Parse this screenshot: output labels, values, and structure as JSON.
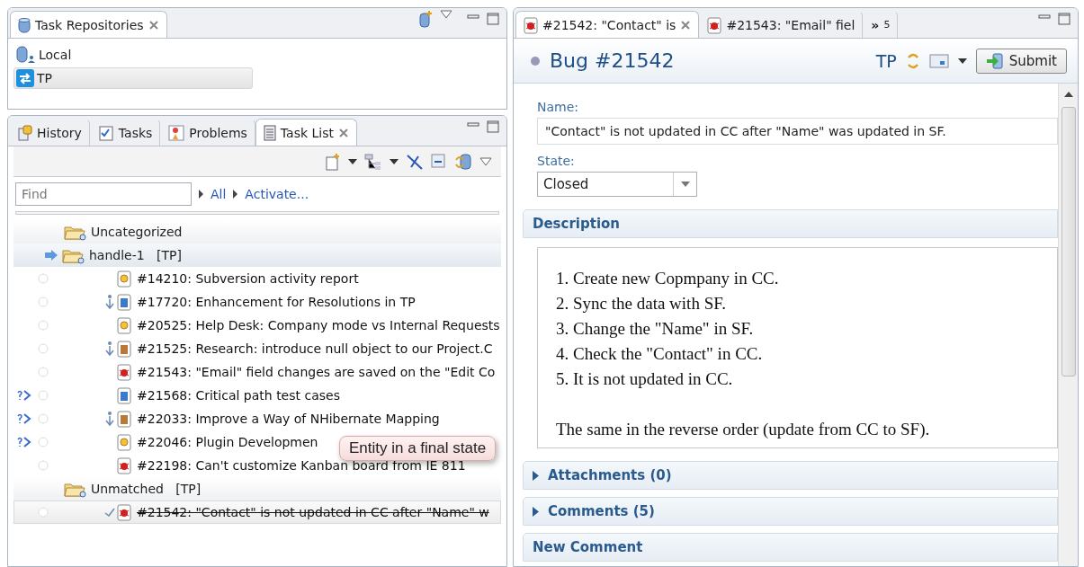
{
  "repositories": {
    "tab": {
      "label": "Task Repositories"
    },
    "items": [
      {
        "label": "Local",
        "kind": "local",
        "selected": false
      },
      {
        "label": "TP",
        "kind": "remote",
        "selected": true
      }
    ]
  },
  "task_view": {
    "tabs": [
      {
        "label": "History",
        "kind": "history",
        "selected": false
      },
      {
        "label": "Tasks",
        "kind": "tasks",
        "selected": false
      },
      {
        "label": "Problems",
        "kind": "problems",
        "selected": false
      },
      {
        "label": "Task List",
        "kind": "tasklist",
        "selected": true
      }
    ],
    "find": {
      "placeholder": "Find"
    },
    "links": [
      "All",
      "Activate..."
    ],
    "tree": [
      {
        "label": "Uncategorized",
        "active": false
      },
      {
        "label": "handle-1",
        "repo": "[TP]",
        "active": true,
        "children": [
          {
            "label": "#14210: Subversion activity report",
            "kind": "story",
            "incoming": false,
            "outgoing": false,
            "completed": false
          },
          {
            "label": "#17720: Enhancement for Resolutions in TP",
            "kind": "task",
            "incoming": false,
            "outgoing": true,
            "completed": false
          },
          {
            "label": "#20525: Help Desk: Company mode vs Internal Requests",
            "kind": "story",
            "incoming": false,
            "outgoing": false,
            "completed": false
          },
          {
            "label": "#21525: Research: introduce null object to our Project.C",
            "kind": "feature",
            "incoming": false,
            "outgoing": true,
            "completed": false
          },
          {
            "label": "#21543: \"Email\" field changes are saved on the \"Edit Co",
            "kind": "bug",
            "incoming": false,
            "outgoing": false,
            "completed": false
          },
          {
            "label": "#21568: Critical path test cases",
            "kind": "task",
            "incoming": true,
            "outgoing": false,
            "completed": false
          },
          {
            "label": "#22033: Improve a Way of NHibernate Mapping",
            "kind": "feature",
            "incoming": true,
            "outgoing": true,
            "completed": false
          },
          {
            "label": "#22046: Plugin Developmen",
            "kind": "story",
            "incoming": true,
            "outgoing": false,
            "completed": false
          },
          {
            "label": "#22198: Can't customize Kanban board from IE 811",
            "kind": "bug",
            "incoming": false,
            "outgoing": false,
            "completed": false
          }
        ]
      },
      {
        "label": "Unmatched",
        "repo": "[TP]",
        "active": false,
        "children": [
          {
            "label": "#21542: \"Contact\" is not updated in CC after \"Name\" w",
            "kind": "bug",
            "incoming": false,
            "outgoing": false,
            "completed": true
          }
        ]
      }
    ],
    "callout": "Entity in a final state"
  },
  "editor": {
    "tabs": [
      {
        "label": "#21542: \"Contact\" is",
        "selected": true
      },
      {
        "label": "#21543: \"Email\" fiel",
        "selected": false
      }
    ],
    "overflow": {
      "symbol": "»",
      "count": "5"
    },
    "header": {
      "title": "Bug #21542",
      "repo": "TP",
      "submit": "Submit"
    },
    "name": {
      "label": "Name:",
      "value": "\"Contact\" is not updated in CC after \"Name\" was updated in SF."
    },
    "state": {
      "label": "State:",
      "value": "Closed"
    },
    "description": {
      "title": "Description",
      "lines": [
        "1. Create new Copmpany in CC.",
        "2. Sync the data with SF.",
        "3. Change the \"Name\" in SF.",
        "4. Check the \"Contact\" in CC.",
        "5. It is not updated in CC."
      ],
      "note": "The same in the reverse order (update from CC to SF)."
    },
    "sections": [
      {
        "label": "Attachments (0)",
        "expanded": false
      },
      {
        "label": "Comments (5)",
        "expanded": false
      }
    ],
    "new_comment": "New Comment"
  }
}
